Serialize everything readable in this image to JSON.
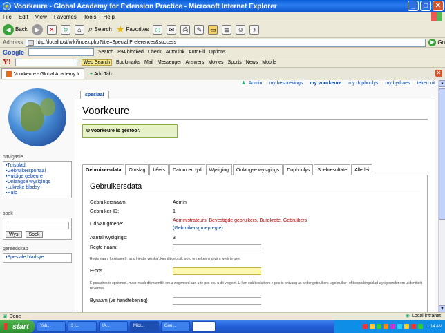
{
  "window": {
    "title": "Voorkeure - Global Academy for Extension Practice - Microsoft Internet Explorer"
  },
  "menubar": [
    "File",
    "Edit",
    "View",
    "Favorites",
    "Tools",
    "Help"
  ],
  "toolbar": {
    "back": "Back",
    "search": "Search",
    "favorites": "Favorites"
  },
  "address": {
    "label": "Address",
    "url": "http://localhost/wiki/index.php?title=Special:Preferences&success",
    "go": "Go"
  },
  "googlebar": {
    "logo": "Google",
    "search_label": "Search",
    "blocked": "894 blocked",
    "check": "Check",
    "autolink": "AutoLink",
    "autofill": "AutoFill",
    "options": "Options"
  },
  "yahoobar": {
    "logo": "Y!",
    "websearch": "Web Search",
    "bookmarks": "Bookmarks",
    "mail": "Mail",
    "messenger": "Messenger",
    "answers": "Answers",
    "movies": "Movies",
    "sports": "Sports",
    "news": "News",
    "mobile": "Mobile"
  },
  "tabs": {
    "current": "Voorkeure - Global Academy for ...",
    "add": "Add Tab"
  },
  "personal": {
    "user": "Admin",
    "links": [
      "my besprekings",
      "my voorkeure",
      "my dophoulys",
      "my bydraes",
      "teken uit"
    ]
  },
  "sidebar": {
    "nav_heading": "navigasie",
    "nav_items": [
      "Tuisblad",
      "Gebruikersportaal",
      "Huidige gebeure",
      "Onlangse wysigings",
      "Lukrake bladsy",
      "Hulp"
    ],
    "search_heading": "soek",
    "btn_go": "Wys",
    "btn_search": "Soek",
    "tools_heading": "gereedskap",
    "tools_items": [
      "Spesiale bladsye"
    ]
  },
  "content": {
    "tab": "spesiaal",
    "title": "Voorkeure",
    "success": "U voorkeure is gestoor.",
    "pref_tabs": [
      "Gebruikersdata",
      "Omslag",
      "Lêers",
      "Datum en tyd",
      "Wysiging",
      "Onlangse wysigings",
      "Dophoulys",
      "Soekresultate",
      "Allerlei"
    ],
    "section": "Gebruikersdata",
    "rows": {
      "username_label": "Gebruikersnaam:",
      "username_value": "Admin",
      "userid_label": "Gebruiker-ID:",
      "userid_value": "1",
      "groups_label": "Lid van groepe:",
      "groups_value": "Administrateurs, Bevestigde gebruikers, Burokrate, Gebruikers",
      "groups_link": "(Gebruikersgroepregte)",
      "edits_label": "Aantal wysigings:",
      "edits_value": "3",
      "realname_label": "Regte naam:",
      "realname_note": "Regte naam (opsioneel): as u hierdie verskaf, kan dit gebruik word om erkenning vir u werk te gee.",
      "email_label": "E-pos",
      "email_note": "E-posadres is opsioneel, maar maak dit moontlik om u wagwoord aan u te pos sou u dit vergeet. U kan ook besluit om e-pos te ontvang as ander gebruikers u gebruiker- of besprekingsblad wysig sonder om u identiteit te verraai.",
      "nick_label": "Bynaam (vir handtekening)"
    }
  },
  "statusbar": {
    "left": "Done",
    "right": "Local intranet"
  },
  "taskbar": {
    "start": "start",
    "tasks": [
      "Yah...",
      "3 I...",
      "IA...",
      "Micr...",
      "Goo...",
      ""
    ],
    "clock": "1:14 AM"
  }
}
